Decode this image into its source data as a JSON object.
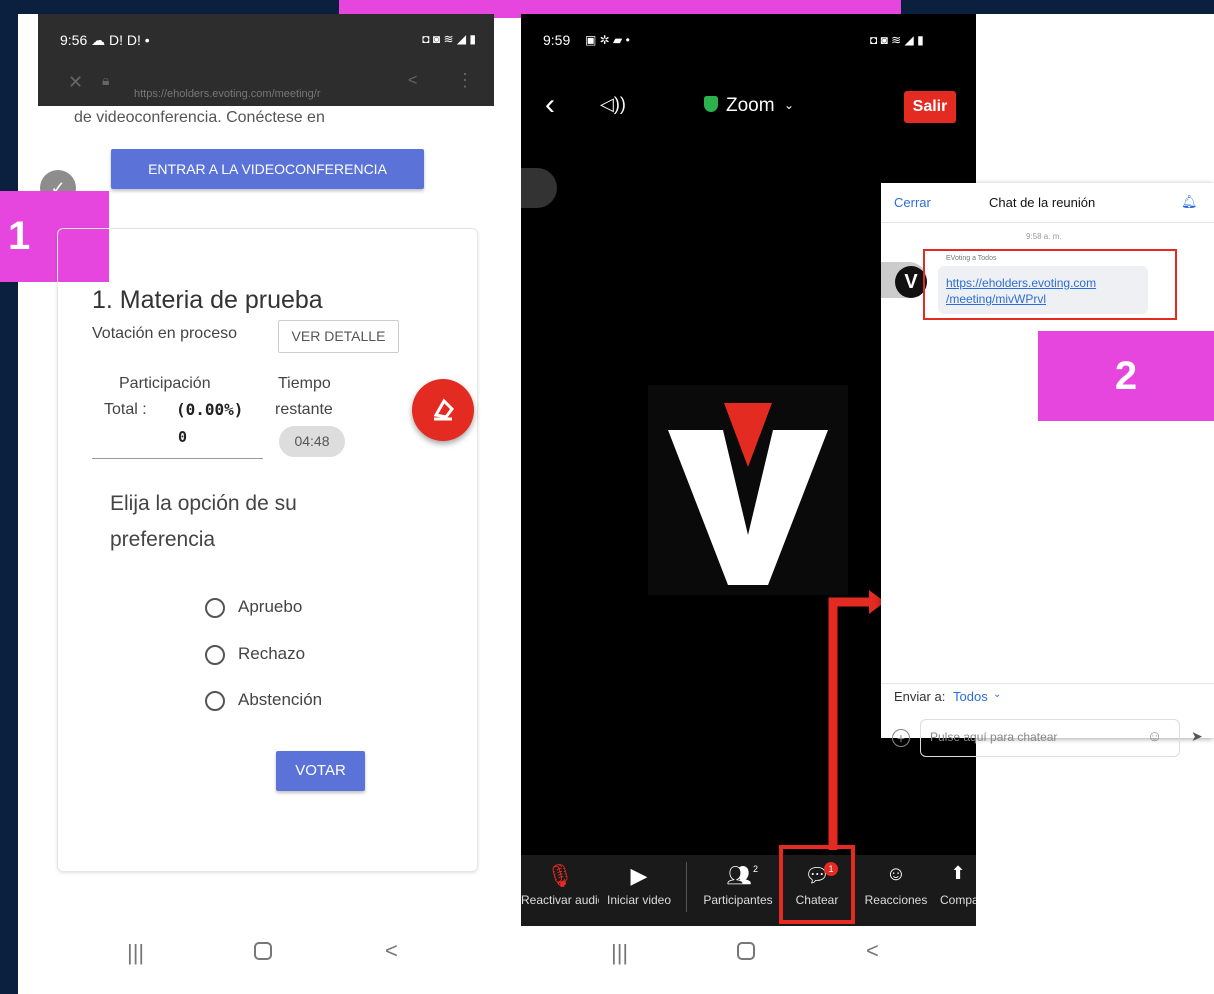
{
  "labels": {
    "step1": "1",
    "step2": "2"
  },
  "phone_left": {
    "status_time": "9:56 ☁ D! D! •",
    "url": "https://eholders.evoting.com/meeting/r",
    "intro_text": "de videoconferencia. Conéctese en",
    "enter_button": "ENTRAR A LA VIDEOCONFERENCIA",
    "card": {
      "title": "1. Materia de prueba",
      "status": "Votación en proceso",
      "details_button": "VER DETALLE",
      "participation_label": "Participación",
      "total_label": "Total :",
      "total_pct": "(0.00%)",
      "total_count": "0",
      "time_label_1": "Tiempo",
      "time_label_2": "restante",
      "time_value": "04:48",
      "question_1": "Elija la opción de su",
      "question_2": "preferencia",
      "options": [
        "Apruebo",
        "Rechazo",
        "Abstención"
      ],
      "vote_button": "VOTAR"
    }
  },
  "phone_right": {
    "status_time": "9:59",
    "zoom_label": "Zoom",
    "leave_button": "Salir",
    "toolbar": [
      {
        "label": "Reactivar audio",
        "icon": "muted-mic-icon"
      },
      {
        "label": "Iniciar video",
        "icon": "video-off-icon"
      },
      {
        "label": "Participantes",
        "icon": "participants-icon"
      },
      {
        "label": "Chatear",
        "icon": "chat-icon"
      },
      {
        "label": "Reacciones",
        "icon": "reactions-icon"
      },
      {
        "label": "Compartir",
        "icon": "share-icon"
      }
    ],
    "chat_badge": "1",
    "participants_count": "2"
  },
  "chat": {
    "close": "Cerrar",
    "title": "Chat de la reunión",
    "timestamp": "9:58 a. m.",
    "sender": "EVoting a Todos",
    "link_line1": "https://eholders.evoting.com",
    "link_line2": "/meeting/mivWPrvl",
    "send_to_label": "Enviar a:",
    "send_to_value": "Todos",
    "input_placeholder": "Pulse aquí para chatear"
  },
  "colors": {
    "accent": "#e646de",
    "zoom_red": "#e32b22",
    "button_blue": "#5b72d9",
    "link_blue": "#2b6ed8"
  }
}
